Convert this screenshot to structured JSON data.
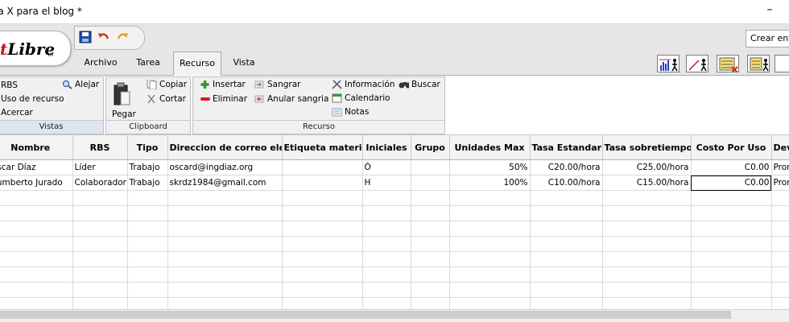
{
  "window": {
    "title": "la X para el blog *",
    "minimize_glyph": "–"
  },
  "logo": {
    "text_red": "t",
    "text_black": "Libre",
    "tm": "TM"
  },
  "quick_access": [
    "save-icon",
    "undo-icon",
    "redo-icon"
  ],
  "menu_tabs": [
    {
      "label": "Archivo"
    },
    {
      "label": "Tarea"
    },
    {
      "label": "Recurso",
      "active": true
    },
    {
      "label": "Vista"
    }
  ],
  "search": {
    "placeholder": "Crear entra"
  },
  "toolbar_icons": [
    "resource-histogram-icon",
    "resource-usage-chart-icon",
    "resource-report-icon",
    "task-report-icon"
  ],
  "ribbon": {
    "vistas": {
      "title": "Vistas",
      "items": {
        "rbs": "RBS",
        "uso": "Uso de recurso",
        "acercar": "Acercar",
        "alejar": "Alejar"
      }
    },
    "clipboard": {
      "title": "Clipboard",
      "items": {
        "pegar": "Pegar",
        "copiar": "Copiar",
        "cortar": "Cortar"
      }
    },
    "recurso": {
      "title": "Recurso",
      "items": {
        "insertar": "Insertar",
        "eliminar": "Eliminar",
        "sangrar": "Sangrar",
        "anular": "Anular sangria",
        "informacion": "Información",
        "calendario": "Calendario",
        "notas": "Notas",
        "buscar": "Buscar"
      }
    }
  },
  "accent_colors": {
    "logo_red": "#c0141d",
    "insert_green": "#2e9a2e",
    "delete_red": "#d22020",
    "vistas_footer": "#dde6f0"
  },
  "table": {
    "columns": [
      "Nombre",
      "RBS",
      "Tipo",
      "Direccion de correo elec...",
      "Etiqueta material",
      "Iniciales",
      "Grupo",
      "Unidades Max",
      "Tasa Estandar",
      "Tasa sobretiempo",
      "Costo Por Uso",
      "Dev"
    ],
    "rows": [
      [
        "Óscar Díaz",
        "Líder",
        "Trabajo",
        "oscard@ingdiaz.org",
        "",
        "Ó",
        "",
        "50%",
        "C20.00/hora",
        "C25.00/hora",
        "C0.00",
        "Prorra"
      ],
      [
        "Humberto Jurado",
        "Colaborador",
        "Trabajo",
        "skrdz1984@gmail.com",
        "",
        "H",
        "",
        "100%",
        "C10.00/hora",
        "C15.00/hora",
        "C0.00",
        "Prorra"
      ]
    ]
  }
}
